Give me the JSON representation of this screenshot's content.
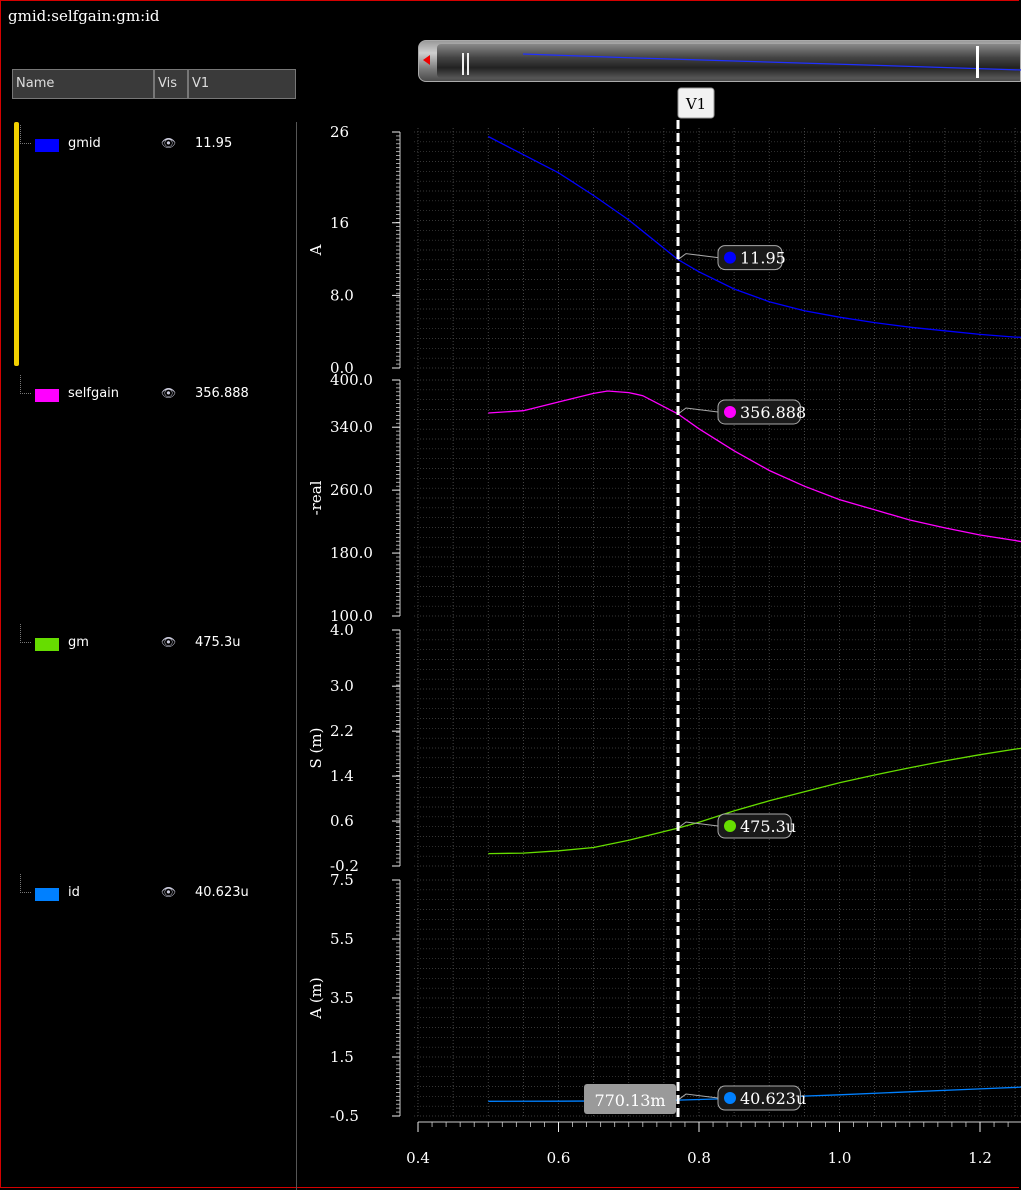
{
  "window_title": "gmid:selfgain:gm:id",
  "table_header": {
    "name": "Name",
    "vis": "Vis",
    "v1": "V1"
  },
  "signals": [
    {
      "name": "gmid",
      "color": "#0000ff",
      "value": "11.95"
    },
    {
      "name": "selfgain",
      "color": "#ff00ff",
      "value": "356.888"
    },
    {
      "name": "gm",
      "color": "#66dd00",
      "value": "475.3u"
    },
    {
      "name": "id",
      "color": "#0080ff",
      "value": "40.623u"
    }
  ],
  "cursor": {
    "label": "V1",
    "x": 0.77013,
    "x_readout": "770.13m"
  },
  "chart_data": {
    "type": "line",
    "x_axis": {
      "range": [
        0.4,
        1.3
      ],
      "ticks": [
        0.4,
        0.6,
        0.8,
        1.0,
        1.2
      ],
      "tick_labels": [
        "0.4",
        "0.6",
        "0.8",
        "1.0",
        "1.2"
      ]
    },
    "panels": [
      {
        "signal": "gmid",
        "ylabel": "A",
        "color": "#0000ff",
        "ylim": [
          0,
          26
        ],
        "ticks": [
          0,
          8,
          16,
          26
        ],
        "tick_labels": [
          "0.0",
          "8.0",
          "16",
          "26"
        ],
        "marker_label": "11.95",
        "x": [
          0.5,
          0.55,
          0.6,
          0.65,
          0.7,
          0.77,
          0.8,
          0.85,
          0.9,
          0.95,
          1.0,
          1.05,
          1.1,
          1.15,
          1.2,
          1.25,
          1.3
        ],
        "y": [
          25.5,
          23.5,
          21.5,
          19,
          16.3,
          11.95,
          10.6,
          8.7,
          7.3,
          6.3,
          5.6,
          5.0,
          4.5,
          4.1,
          3.7,
          3.4,
          3.3
        ]
      },
      {
        "signal": "selfgain",
        "ylabel": "-real",
        "color": "#ff00ff",
        "ylim": [
          100,
          400
        ],
        "ticks": [
          100,
          180,
          260,
          340,
          400
        ],
        "tick_labels": [
          "100.0",
          "180.0",
          "260.0",
          "340.0",
          "400.0"
        ],
        "marker_label": "356.888",
        "x": [
          0.5,
          0.55,
          0.6,
          0.65,
          0.67,
          0.7,
          0.72,
          0.77,
          0.8,
          0.85,
          0.9,
          0.95,
          1.0,
          1.05,
          1.1,
          1.15,
          1.2,
          1.25,
          1.3
        ],
        "y": [
          358,
          361,
          372,
          383,
          386,
          384,
          380,
          356.888,
          338,
          310,
          285,
          265,
          248,
          235,
          222,
          212,
          203,
          196,
          188
        ]
      },
      {
        "signal": "gm",
        "ylabel": "S (m)",
        "color": "#66dd00",
        "ylim": [
          -0.2,
          4.0
        ],
        "ticks": [
          -0.2,
          0.6,
          1.4,
          2.2,
          3.0,
          4.0
        ],
        "tick_labels": [
          "-0.2",
          "0.6",
          "1.4",
          "2.2",
          "3.0",
          "4.0"
        ],
        "marker_label": "475.3u",
        "x": [
          0.5,
          0.55,
          0.6,
          0.65,
          0.7,
          0.77,
          0.8,
          0.85,
          0.9,
          0.95,
          1.0,
          1.05,
          1.1,
          1.15,
          1.2,
          1.25,
          1.3
        ],
        "y": [
          0.02,
          0.03,
          0.07,
          0.13,
          0.26,
          0.4753,
          0.58,
          0.78,
          0.96,
          1.12,
          1.28,
          1.42,
          1.55,
          1.67,
          1.78,
          1.88,
          1.96
        ]
      },
      {
        "signal": "id",
        "ylabel": "A (m)",
        "color": "#0080ff",
        "ylim": [
          -0.5,
          7.5
        ],
        "ticks": [
          -0.5,
          1.5,
          3.5,
          5.5,
          7.5
        ],
        "tick_labels": [
          "-0.5",
          "1.5",
          "3.5",
          "5.5",
          "7.5"
        ],
        "marker_label": "40.623u",
        "x": [
          0.5,
          0.6,
          0.7,
          0.77,
          0.8,
          0.9,
          1.0,
          1.1,
          1.2,
          1.3
        ],
        "y": [
          0.0,
          0.002,
          0.015,
          0.0406,
          0.06,
          0.13,
          0.22,
          0.32,
          0.42,
          0.52
        ]
      }
    ],
    "grid": true,
    "legend_placement": "left"
  }
}
